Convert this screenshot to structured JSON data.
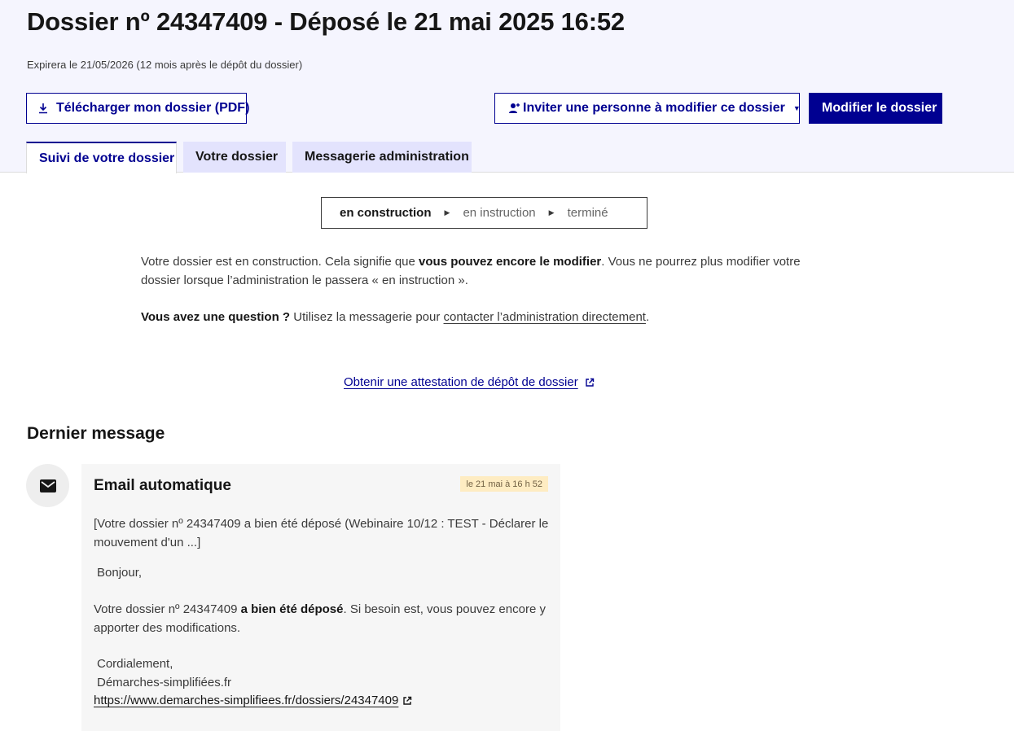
{
  "header": {
    "title": "Dossier nº 24347409 - Déposé le 21 mai 2025 16:52",
    "expiry": "Expirera le 21/05/2026 (12 mois après le dépôt du dossier)",
    "download_label": "Télécharger mon dossier (PDF)",
    "invite_label": "Inviter une personne à modifier ce dossier",
    "invite_caret": "▼",
    "modify_label": "Modifier le dossier"
  },
  "tabs": [
    {
      "label": "Suivi de votre dossier",
      "active": true
    },
    {
      "label": "Votre dossier",
      "active": false
    },
    {
      "label": "Messagerie administration",
      "active": false
    }
  ],
  "status": {
    "current": "en construction",
    "next": "en instruction",
    "last": "terminé",
    "arrow": "▶"
  },
  "info": {
    "p1_a": "Votre dossier est en construction. Cela signifie que ",
    "p1_b": "vous pouvez encore le modifier",
    "p1_c": ". Vous ne pourrez plus modifier votre dossier lorsque l’administration le passera « en instruction ».",
    "p2_a": "Vous avez une question ?",
    "p2_b": " Utilisez la messagerie pour ",
    "p2_link": "contacter l’administration directement",
    "p2_c": "."
  },
  "attestation_link": "Obtenir une attestation de dépôt de dossier",
  "last_message": {
    "section_title": "Dernier message",
    "sender": "Email automatique",
    "date": "le 21 mai à 16 h 52",
    "subject": "[Votre dossier nº 24347409 a bien été déposé (Webinaire 10/12 : TEST - Déclarer le mouvement d'un ...]",
    "greeting": "Bonjour,",
    "body_a": "Votre dossier nº 24347409 ",
    "body_b": "a bien été déposé",
    "body_c": ". Si besoin est, vous pouvez encore y apporter des modifications.",
    "closing": "Cordialement,",
    "signature": "Démarches-simplifiées.fr",
    "url": "https://www.demarches-simplifiees.fr/dossiers/24347409"
  },
  "colors": {
    "primary": "#000091",
    "header_bg": "#f5f5fe",
    "tab_bg": "#e3e3fd",
    "date_badge_bg": "#feecc2",
    "card_bg": "#f6f6f6"
  }
}
